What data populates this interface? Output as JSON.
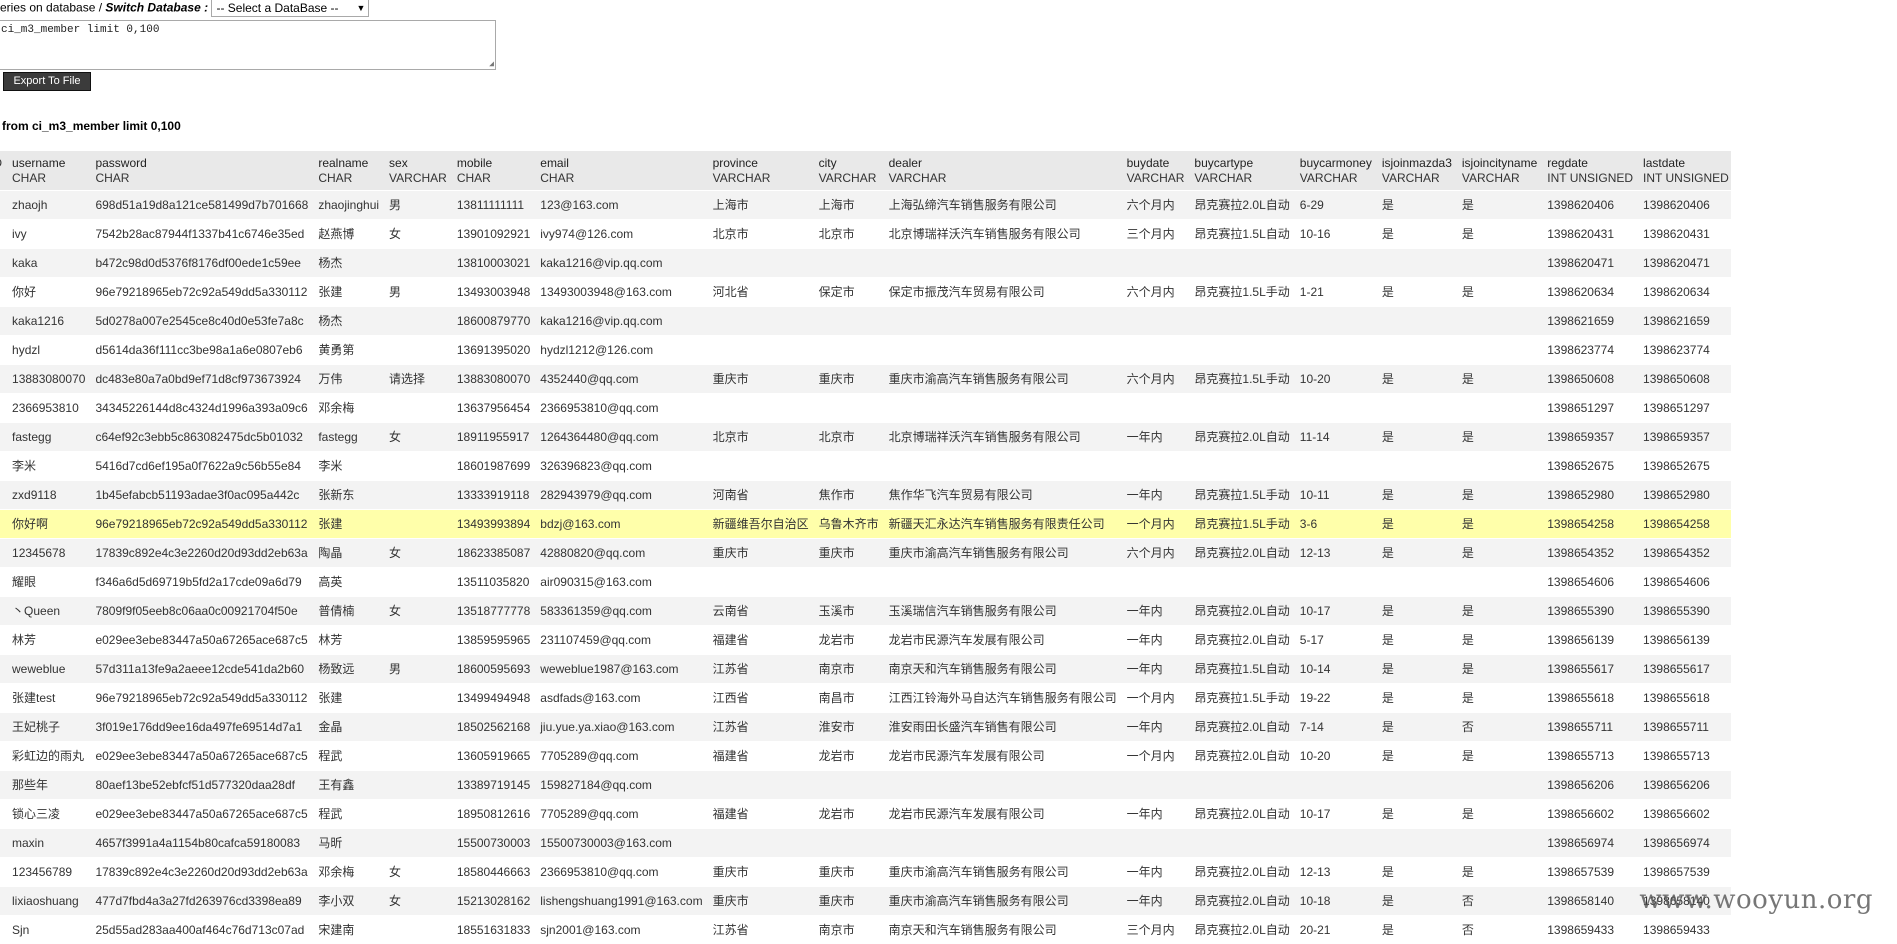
{
  "toolbar": {
    "prefix_text": "eries on database / ",
    "switch_label": "Switch Database :",
    "db_select_value": "-- Select a DataBase --",
    "sql_text": "ci_m3_member limit 0,100",
    "export_label": "Export To File"
  },
  "result_title": "from ci_m3_member limit 0,100",
  "columns": [
    {
      "name": "",
      "type": "IGNED"
    },
    {
      "name": "username",
      "type": "CHAR"
    },
    {
      "name": "password",
      "type": "CHAR"
    },
    {
      "name": "realname",
      "type": "CHAR"
    },
    {
      "name": "sex",
      "type": "VARCHAR"
    },
    {
      "name": "mobile",
      "type": "CHAR"
    },
    {
      "name": "email",
      "type": "CHAR"
    },
    {
      "name": "province",
      "type": "VARCHAR"
    },
    {
      "name": "city",
      "type": "VARCHAR"
    },
    {
      "name": "dealer",
      "type": "VARCHAR"
    },
    {
      "name": "buydate",
      "type": "VARCHAR"
    },
    {
      "name": "buycartype",
      "type": "VARCHAR"
    },
    {
      "name": "buycarmoney",
      "type": "VARCHAR"
    },
    {
      "name": "isjoinmazda3",
      "type": "VARCHAR"
    },
    {
      "name": "isjoincityname",
      "type": "VARCHAR"
    },
    {
      "name": "regdate",
      "type": "INT UNSIGNED"
    },
    {
      "name": "lastdate",
      "type": "INT UNSIGNED"
    }
  ],
  "rows": [
    [
      "",
      "zhaojh",
      "698d51a19d8a121ce581499d7b701668",
      "zhaojinghui",
      "男",
      "13811111111",
      "123@163.com",
      "上海市",
      "上海市",
      "上海弘缔汽车销售服务有限公司",
      "六个月内",
      "昂克赛拉2.0L自动",
      "6-29",
      "是",
      "是",
      "1398620406",
      "1398620406"
    ],
    [
      "",
      "ivy",
      "7542b28ac87944f1337b41c6746e35ed",
      "赵燕博",
      "女",
      "13901092921",
      "ivy974@126.com",
      "北京市",
      "北京市",
      "北京博瑞祥沃汽车销售服务有限公司",
      "三个月内",
      "昂克赛拉1.5L自动",
      "10-16",
      "是",
      "是",
      "1398620431",
      "1398620431"
    ],
    [
      "",
      "kaka",
      "b472c98d0d5376f8176df00ede1c59ee",
      "杨杰",
      "",
      "13810003021",
      "kaka1216@vip.qq.com",
      "",
      "",
      "",
      "",
      "",
      "",
      "",
      "",
      "1398620471",
      "1398620471"
    ],
    [
      "",
      "你好",
      "96e79218965eb72c92a549dd5a330112",
      "张建",
      "男",
      "13493003948",
      "13493003948@163.com",
      "河北省",
      "保定市",
      "保定市振茂汽车贸易有限公司",
      "六个月内",
      "昂克赛拉1.5L手动",
      "1-21",
      "是",
      "是",
      "1398620634",
      "1398620634"
    ],
    [
      "",
      "kaka1216",
      "5d0278a007e2545ce8c40d0e53fe7a8c",
      "杨杰",
      "",
      "18600879770",
      "kaka1216@vip.qq.com",
      "",
      "",
      "",
      "",
      "",
      "",
      "",
      "",
      "1398621659",
      "1398621659"
    ],
    [
      "",
      "hydzl",
      "d5614da36f111cc3be98a1a6e0807eb6",
      "黄勇第",
      "",
      "13691395020",
      "hydzl1212@126.com",
      "",
      "",
      "",
      "",
      "",
      "",
      "",
      "",
      "1398623774",
      "1398623774"
    ],
    [
      "",
      "13883080070",
      "dc483e80a7a0bd9ef71d8cf973673924",
      "万伟",
      "请选择",
      "13883080070",
      "4352440@qq.com",
      "重庆市",
      "重庆市",
      "重庆市渝高汽车销售服务有限公司",
      "六个月内",
      "昂克赛拉1.5L手动",
      "10-20",
      "是",
      "是",
      "1398650608",
      "1398650608"
    ],
    [
      "",
      "2366953810",
      "34345226144d8c4324d1996a393a09c6",
      "邓余梅",
      "",
      "13637956454",
      "2366953810@qq.com",
      "",
      "",
      "",
      "",
      "",
      "",
      "",
      "",
      "1398651297",
      "1398651297"
    ],
    [
      "",
      "fastegg",
      "c64ef92c3ebb5c863082475dc5b01032",
      "fastegg",
      "女",
      "18911955917",
      "1264364480@qq.com",
      "北京市",
      "北京市",
      "北京博瑞祥沃汽车销售服务有限公司",
      "一年内",
      "昂克赛拉2.0L自动",
      "11-14",
      "是",
      "是",
      "1398659357",
      "1398659357"
    ],
    [
      "",
      "李米",
      "5416d7cd6ef195a0f7622a9c56b55e84",
      "李米",
      "",
      "18601987699",
      "326396823@qq.com",
      "",
      "",
      "",
      "",
      "",
      "",
      "",
      "",
      "1398652675",
      "1398652675"
    ],
    [
      "",
      "zxd9118",
      "1b45efabcb51193adae3f0ac095a442c",
      "张新东",
      "",
      "13333919118",
      "282943979@qq.com",
      "河南省",
      "焦作市",
      "焦作华飞汽车贸易有限公司",
      "一年内",
      "昂克赛拉1.5L手动",
      "10-11",
      "是",
      "是",
      "1398652980",
      "1398652980"
    ],
    [
      "",
      "你好啊",
      "96e79218965eb72c92a549dd5a330112",
      "张建",
      "",
      "13493993894",
      "bdzj@163.com",
      "新疆维吾尔自治区",
      "乌鲁木齐市",
      "新疆天汇永达汽车销售服务有限责任公司",
      "一个月内",
      "昂克赛拉1.5L手动",
      "3-6",
      "是",
      "是",
      "1398654258",
      "1398654258"
    ],
    [
      "",
      "12345678",
      "17839c892e4c3e2260d20d93dd2eb63a",
      "陶晶",
      "女",
      "18623385087",
      "42880820@qq.com",
      "重庆市",
      "重庆市",
      "重庆市渝高汽车销售服务有限公司",
      "六个月内",
      "昂克赛拉2.0L自动",
      "12-13",
      "是",
      "是",
      "1398654352",
      "1398654352"
    ],
    [
      "",
      "耀眼",
      "f346a6d5d69719b5fd2a17cde09a6d79",
      "高英",
      "",
      "13511035820",
      "air090315@163.com",
      "",
      "",
      "",
      "",
      "",
      "",
      "",
      "",
      "1398654606",
      "1398654606"
    ],
    [
      "",
      "丶Queen",
      "7809f9f05eeb8c06aa0c00921704f50e",
      "普倩楠",
      "女",
      "13518777778",
      "583361359@qq.com",
      "云南省",
      "玉溪市",
      "玉溪瑞信汽车销售服务有限公司",
      "一年内",
      "昂克赛拉2.0L自动",
      "10-17",
      "是",
      "是",
      "1398655390",
      "1398655390"
    ],
    [
      "",
      "林芳",
      "e029ee3ebe83447a50a67265ace687c5",
      "林芳",
      "",
      "13859595965",
      "231107459@qq.com",
      "福建省",
      "龙岩市",
      "龙岩市民源汽车发展有限公司",
      "一年内",
      "昂克赛拉2.0L自动",
      "5-17",
      "是",
      "是",
      "1398656139",
      "1398656139"
    ],
    [
      "",
      "weweblue",
      "57d311a13fe9a2aeee12cde541da2b60",
      "杨致远",
      "男",
      "18600595693",
      "weweblue1987@163.com",
      "江苏省",
      "南京市",
      "南京天和汽车销售服务有限公司",
      "一年内",
      "昂克赛拉1.5L自动",
      "10-14",
      "是",
      "是",
      "1398655617",
      "1398655617"
    ],
    [
      "",
      "张建test",
      "96e79218965eb72c92a549dd5a330112",
      "张建",
      "",
      "13499494948",
      "asdfads@163.com",
      "江西省",
      "南昌市",
      "江西江铃海外马自达汽车销售服务有限公司",
      "一个月内",
      "昂克赛拉1.5L手动",
      "19-22",
      "是",
      "是",
      "1398655618",
      "1398655618"
    ],
    [
      "",
      "王妃桃子",
      "3f019e176dd9ee16da497fe69514d7a1",
      "金晶",
      "",
      "18502562168",
      "jiu.yue.ya.xiao@163.com",
      "江苏省",
      "淮安市",
      "淮安雨田长盛汽车销售有限公司",
      "一年内",
      "昂克赛拉2.0L自动",
      "7-14",
      "是",
      "否",
      "1398655711",
      "1398655711"
    ],
    [
      "",
      "彩虹边的雨丸",
      "e029ee3ebe83447a50a67265ace687c5",
      "程武",
      "",
      "13605919665",
      "7705289@qq.com",
      "福建省",
      "龙岩市",
      "龙岩市民源汽车发展有限公司",
      "一个月内",
      "昂克赛拉2.0L自动",
      "10-20",
      "是",
      "是",
      "1398655713",
      "1398655713"
    ],
    [
      "",
      "那些年",
      "80aef13be52ebfcf51d577320daa28df",
      "王有鑫",
      "",
      "13389719145",
      "159827184@qq.com",
      "",
      "",
      "",
      "",
      "",
      "",
      "",
      "",
      "1398656206",
      "1398656206"
    ],
    [
      "",
      "锁心三凌",
      "e029ee3ebe83447a50a67265ace687c5",
      "程武",
      "",
      "18950812616",
      "7705289@qq.com",
      "福建省",
      "龙岩市",
      "龙岩市民源汽车发展有限公司",
      "一年内",
      "昂克赛拉2.0L自动",
      "10-17",
      "是",
      "是",
      "1398656602",
      "1398656602"
    ],
    [
      "",
      "maxin",
      "4657f3991a4a1154b80cafca59180083",
      "马昕",
      "",
      "15500730003",
      "15500730003@163.com",
      "",
      "",
      "",
      "",
      "",
      "",
      "",
      "",
      "1398656974",
      "1398656974"
    ],
    [
      "",
      "123456789",
      "17839c892e4c3e2260d20d93dd2eb63a",
      "邓余梅",
      "女",
      "18580446663",
      "2366953810@qq.com",
      "重庆市",
      "重庆市",
      "重庆市渝高汽车销售服务有限公司",
      "一年内",
      "昂克赛拉2.0L自动",
      "12-13",
      "是",
      "是",
      "1398657539",
      "1398657539"
    ],
    [
      "",
      "lixiaoshuang",
      "477d7fbd4a3a27fd263976cd3398ea89",
      "李小双",
      "女",
      "15213028162",
      "lishengshuang1991@163.com",
      "重庆市",
      "重庆市",
      "重庆市渝高汽车销售服务有限公司",
      "一年内",
      "昂克赛拉2.0L自动",
      "10-18",
      "是",
      "否",
      "1398658140",
      "1398658140"
    ],
    [
      "",
      "Sjn",
      "25d55ad283aa400af464c76d713c07ad",
      "宋建南",
      "",
      "18551631833",
      "sjn2001@163.com",
      "江苏省",
      "南京市",
      "南京天和汽车销售服务有限公司",
      "三个月内",
      "昂克赛拉2.0L自动",
      "20-21",
      "是",
      "否",
      "1398659433",
      "1398659433"
    ]
  ],
  "highlight_row": 11,
  "watermark": "www.wooyun.org",
  "colors": {
    "header_bg": "#e9e9e9",
    "row_alt": "#f3f3f3",
    "highlight": "#ffffaa",
    "button_bg": "#3b3b3b"
  }
}
